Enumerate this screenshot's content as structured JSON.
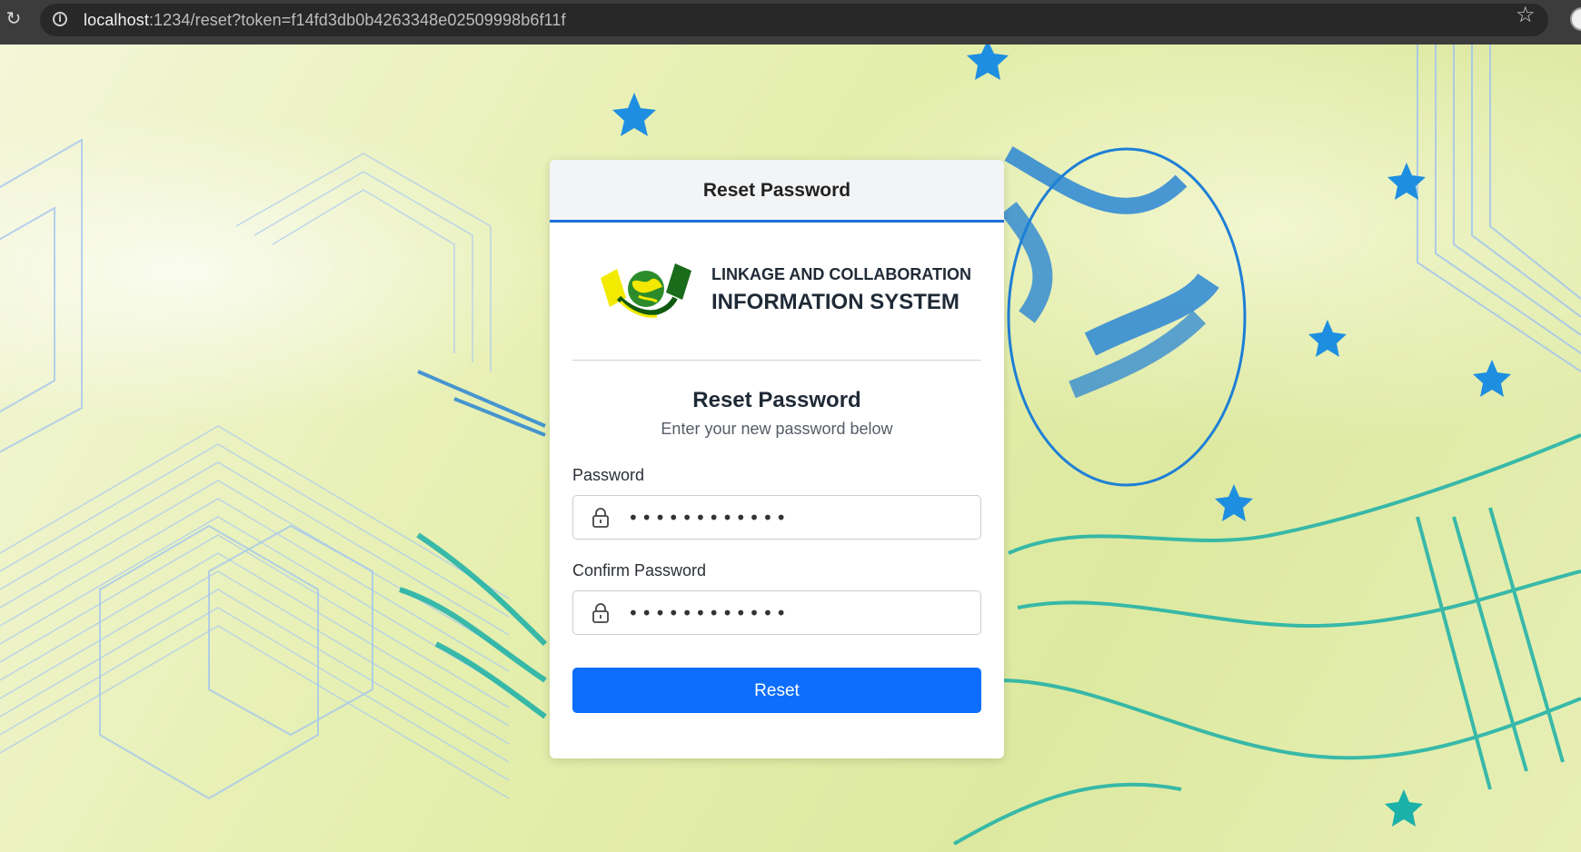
{
  "browser": {
    "url_host": "localhost",
    "url_rest": ":1234/reset?token=f14fd3db0b4263348e02509998b6f11f",
    "reload_icon": "reload-icon",
    "info_icon": "info-icon",
    "star_icon": "bookmark-star-icon"
  },
  "card": {
    "header_title": "Reset Password",
    "brand_line1": "LINKAGE AND COLLABORATION",
    "brand_line2": "INFORMATION SYSTEM",
    "form_title": "Reset Password",
    "form_subtitle": "Enter your new password below",
    "password_label": "Password",
    "password_value": "••••••••••••",
    "confirm_label": "Confirm Password",
    "confirm_value": "••••••••••••",
    "reset_button": "Reset"
  },
  "colors": {
    "accent": "#0d6efd",
    "header_border": "#1d6fdc",
    "background": "#e5efae"
  }
}
